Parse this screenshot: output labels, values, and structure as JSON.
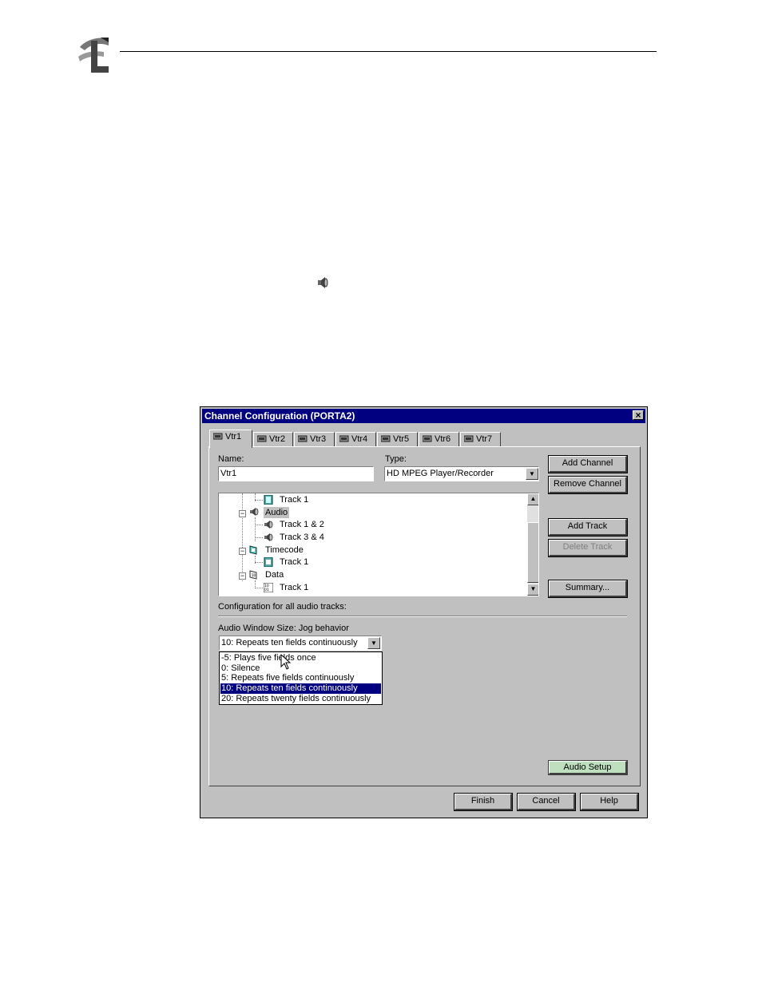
{
  "dialog": {
    "title": "Channel Configuration (PORTA2)",
    "close_label": "×",
    "tabs": [
      {
        "label": "Vtr1",
        "active": true
      },
      {
        "label": "Vtr2",
        "active": false
      },
      {
        "label": "Vtr3",
        "active": false
      },
      {
        "label": "Vtr4",
        "active": false
      },
      {
        "label": "Vtr5",
        "active": false
      },
      {
        "label": "Vtr6",
        "active": false
      },
      {
        "label": "Vtr7",
        "active": false
      }
    ],
    "name_label": "Name:",
    "name_value": "Vtr1",
    "type_label": "Type:",
    "type_value": "HD MPEG Player/Recorder",
    "buttons": {
      "add_channel": "Add Channel",
      "remove_channel": "Remove Channel",
      "add_track": "Add Track",
      "delete_track": "Delete Track",
      "summary": "Summary...",
      "audio_setup": "Audio Setup",
      "finish": "Finish",
      "cancel": "Cancel",
      "help": "Help"
    },
    "tree": {
      "items": [
        {
          "label": "Track 1",
          "icon": "video-track-icon"
        },
        {
          "label": "Audio",
          "icon": "speaker-icon",
          "selected": true
        },
        {
          "label": "Track 1 & 2",
          "icon": "speaker-icon"
        },
        {
          "label": "Track 3 & 4",
          "icon": "speaker-icon"
        },
        {
          "label": "Timecode",
          "icon": "timecode-icon"
        },
        {
          "label": "Track 1",
          "icon": "timecode-track-icon"
        },
        {
          "label": "Data",
          "icon": "data-icon"
        },
        {
          "label": "Track 1",
          "icon": "data-track-icon"
        }
      ]
    },
    "config_label": "Configuration for all audio tracks:",
    "audio_window_label": "Audio Window Size: Jog behavior",
    "audio_window_value": "10: Repeats ten fields continuously",
    "audio_window_options": [
      "-5: Plays five fields once",
      " 0: Silence",
      " 5: Repeats five fields continuously",
      "10: Repeats ten fields continuously",
      "20: Repeats twenty fields continuously"
    ],
    "audio_window_selected_index": 3,
    "colors": {
      "titlebar": "#000080",
      "face": "#c0c0c0",
      "audio_setup_bg": "#bfe0bf"
    }
  }
}
